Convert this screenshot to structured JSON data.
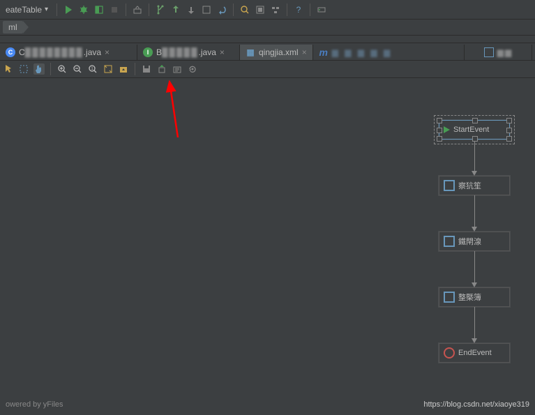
{
  "toolbar": {
    "dropdown_label": "eateTable"
  },
  "breadcrumb": {
    "item": "ml"
  },
  "tabs": [
    {
      "label": "C",
      "ext": ".java"
    },
    {
      "label": "B",
      "ext": ".java"
    },
    {
      "label": "qingjia.xml"
    },
    {
      "label": "m"
    }
  ],
  "flow_nodes": {
    "start": "StartEvent",
    "task1": "察犺笙",
    "task2": "鐵閈湶",
    "task3": "整㮣簿",
    "end": "EndEvent"
  },
  "status_left": "owered by yFiles",
  "watermark": "https://blog.csdn.net/xiaoye319"
}
